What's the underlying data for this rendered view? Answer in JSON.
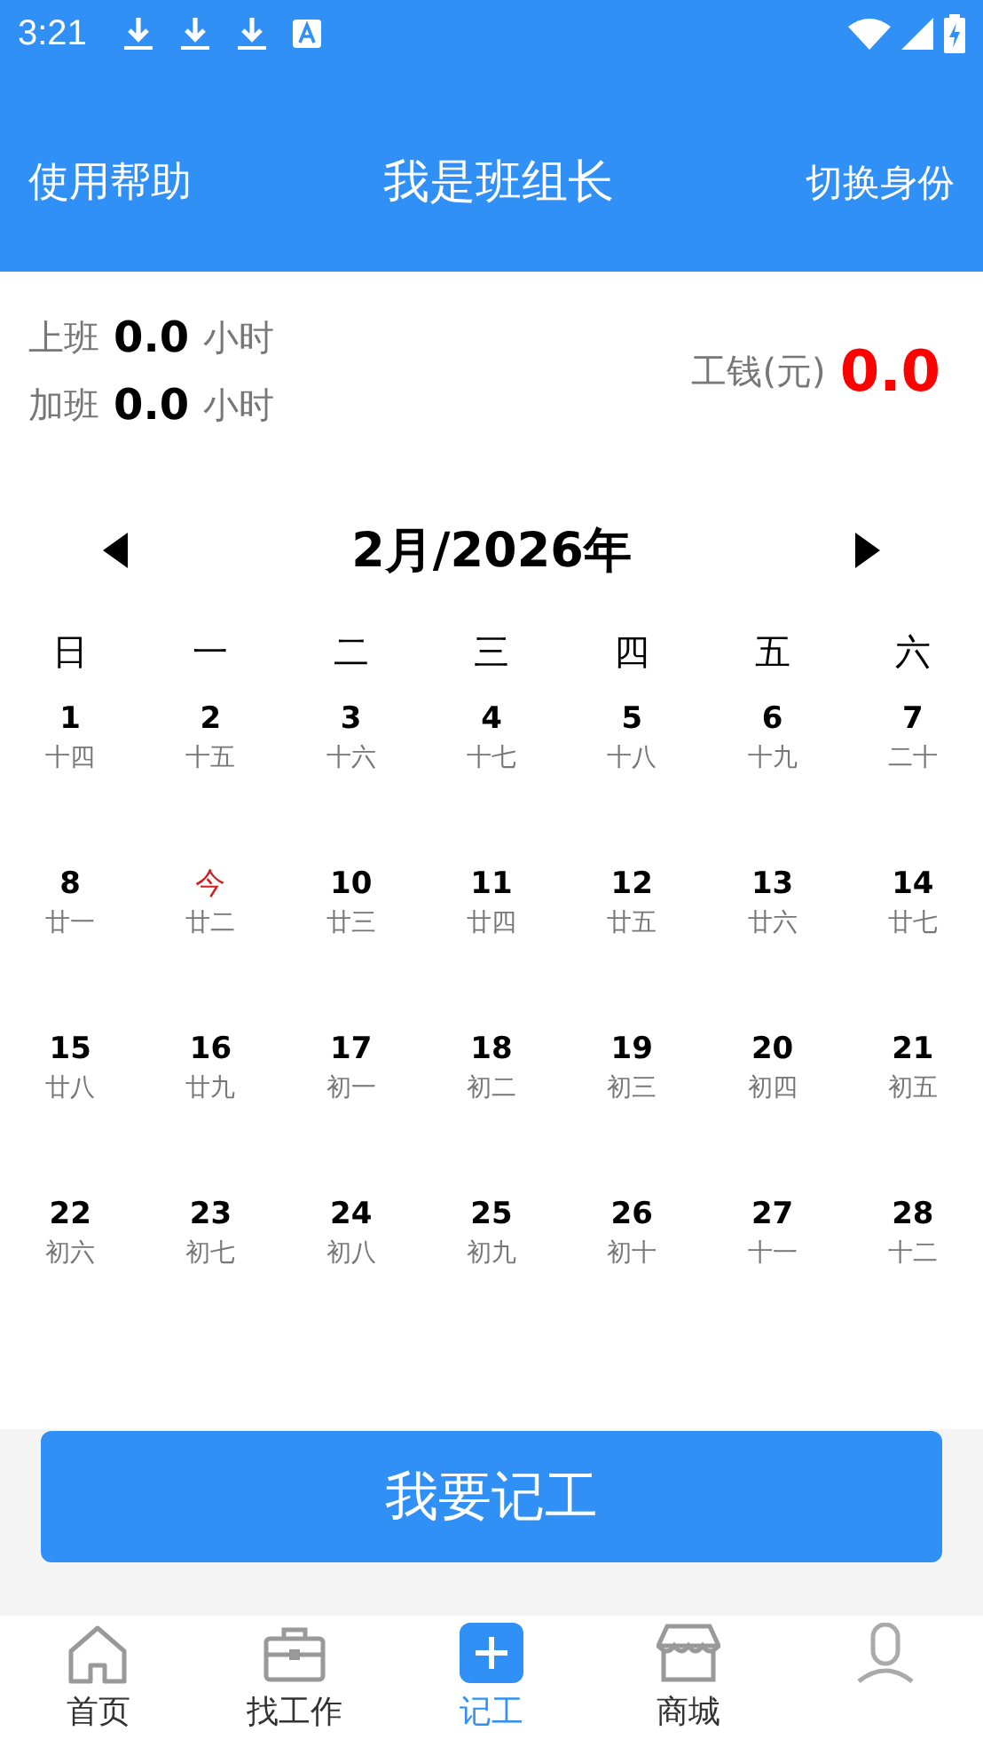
{
  "status_bar": {
    "time": "3:21"
  },
  "header": {
    "left": "使用帮助",
    "title": "我是班组长",
    "right": "切换身份"
  },
  "summary": {
    "rows": [
      {
        "label": "上班",
        "value": "0.0",
        "unit": "小时"
      },
      {
        "label": "加班",
        "value": "0.0",
        "unit": "小时"
      }
    ],
    "wage_label": "工钱(元)",
    "wage": "0.0"
  },
  "calendar": {
    "month": "2月/2026年",
    "weekdays": [
      "日",
      "一",
      "二",
      "三",
      "四",
      "五",
      "六"
    ],
    "days": [
      {
        "day": "1",
        "lunar": "十四",
        "today": false
      },
      {
        "day": "2",
        "lunar": "十五",
        "today": false
      },
      {
        "day": "3",
        "lunar": "十六",
        "today": false
      },
      {
        "day": "4",
        "lunar": "十七",
        "today": false
      },
      {
        "day": "5",
        "lunar": "十八",
        "today": false
      },
      {
        "day": "6",
        "lunar": "十九",
        "today": false
      },
      {
        "day": "7",
        "lunar": "二十",
        "today": false
      },
      {
        "day": "8",
        "lunar": "廿一",
        "today": false
      },
      {
        "day": "今",
        "lunar": "廿二",
        "today": true
      },
      {
        "day": "10",
        "lunar": "廿三",
        "today": false
      },
      {
        "day": "11",
        "lunar": "廿四",
        "today": false
      },
      {
        "day": "12",
        "lunar": "廿五",
        "today": false
      },
      {
        "day": "13",
        "lunar": "廿六",
        "today": false
      },
      {
        "day": "14",
        "lunar": "廿七",
        "today": false
      },
      {
        "day": "15",
        "lunar": "廿八",
        "today": false
      },
      {
        "day": "16",
        "lunar": "廿九",
        "today": false
      },
      {
        "day": "17",
        "lunar": "初一",
        "today": false
      },
      {
        "day": "18",
        "lunar": "初二",
        "today": false
      },
      {
        "day": "19",
        "lunar": "初三",
        "today": false
      },
      {
        "day": "20",
        "lunar": "初四",
        "today": false
      },
      {
        "day": "21",
        "lunar": "初五",
        "today": false
      },
      {
        "day": "22",
        "lunar": "初六",
        "today": false
      },
      {
        "day": "23",
        "lunar": "初七",
        "today": false
      },
      {
        "day": "24",
        "lunar": "初八",
        "today": false
      },
      {
        "day": "25",
        "lunar": "初九",
        "today": false
      },
      {
        "day": "26",
        "lunar": "初十",
        "today": false
      },
      {
        "day": "27",
        "lunar": "十一",
        "today": false
      },
      {
        "day": "28",
        "lunar": "十二",
        "today": false
      }
    ]
  },
  "action_button": "我要记工",
  "nav": [
    {
      "kind": "home",
      "label": "首页",
      "selected": false
    },
    {
      "kind": "work",
      "label": "找工作",
      "selected": false
    },
    {
      "kind": "add",
      "label": "记工",
      "selected": true
    },
    {
      "kind": "shop",
      "label": "商城",
      "selected": false
    },
    {
      "kind": "person",
      "selected": false
    }
  ]
}
